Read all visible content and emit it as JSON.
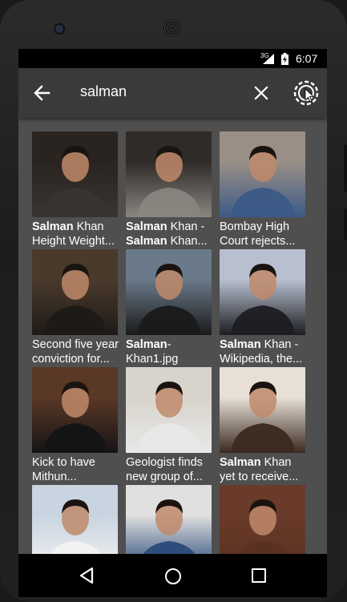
{
  "status_bar": {
    "network": "3G",
    "time": "6:07"
  },
  "toolbar": {
    "search_query": "salman",
    "back_icon": "arrow-left-icon",
    "clear_icon": "close-icon",
    "settings_icon": "settings-cursor-icon"
  },
  "results": [
    {
      "bold": "Salman",
      "line1_rest": " Khan",
      "line2_bold": "",
      "line2": "Height Weight..."
    },
    {
      "bold": "Salman",
      "line1_rest": " Khan -",
      "line2_bold": "Salman",
      "line2": " Khan..."
    },
    {
      "bold": "",
      "line1_rest": "Bombay High",
      "line2_bold": "",
      "line2": "Court rejects..."
    },
    {
      "bold": "",
      "line1_rest": "Second five year",
      "line2_bold": "",
      "line2": "conviction for..."
    },
    {
      "bold": "Salman",
      "line1_rest": "-",
      "line2_bold": "",
      "line2": "Khan1.jpg"
    },
    {
      "bold": "Salman",
      "line1_rest": " Khan -",
      "line2_bold": "",
      "line2": "Wikipedia, the..."
    },
    {
      "bold": "",
      "line1_rest": "Kick to have",
      "line2_bold": "",
      "line2": "Mithun..."
    },
    {
      "bold": "",
      "line1_rest": "Geologist finds",
      "line2_bold": "",
      "line2": "new group of..."
    },
    {
      "bold": "Salman",
      "line1_rest": " Khan",
      "line2_bold": "",
      "line2": "yet to receive..."
    },
    {
      "bold": "",
      "line1_rest": "",
      "line2_bold": "",
      "line2": ""
    },
    {
      "bold": "",
      "line1_rest": "",
      "line2_bold": "",
      "line2": ""
    },
    {
      "bold": "",
      "line1_rest": "",
      "line2_bold": "",
      "line2": ""
    }
  ],
  "thumb_colors": [
    [
      "#2a2420",
      "#3a3532"
    ],
    [
      "#2e2b28",
      "#8a8580"
    ],
    [
      "#9a8f86",
      "#3c5a86"
    ],
    [
      "#4a3a2c",
      "#1e1a17"
    ],
    [
      "#6a7a8a",
      "#1a1a1a"
    ],
    [
      "#b8c0d0",
      "#1c1c22"
    ],
    [
      "#5a3826",
      "#141414"
    ],
    [
      "#d8d4cc",
      "#e8e8e8"
    ],
    [
      "#e8e0d6",
      "#3a2a20"
    ],
    [
      "#c8d4e0",
      "#f2f2f2"
    ],
    [
      "#e0e0e0",
      "#2a4a7a"
    ],
    [
      "#6a3a2a",
      "#5a3020"
    ]
  ],
  "nav_bar": {
    "back_icon": "nav-back-icon",
    "home_icon": "nav-home-icon",
    "recents_icon": "nav-recents-icon"
  }
}
